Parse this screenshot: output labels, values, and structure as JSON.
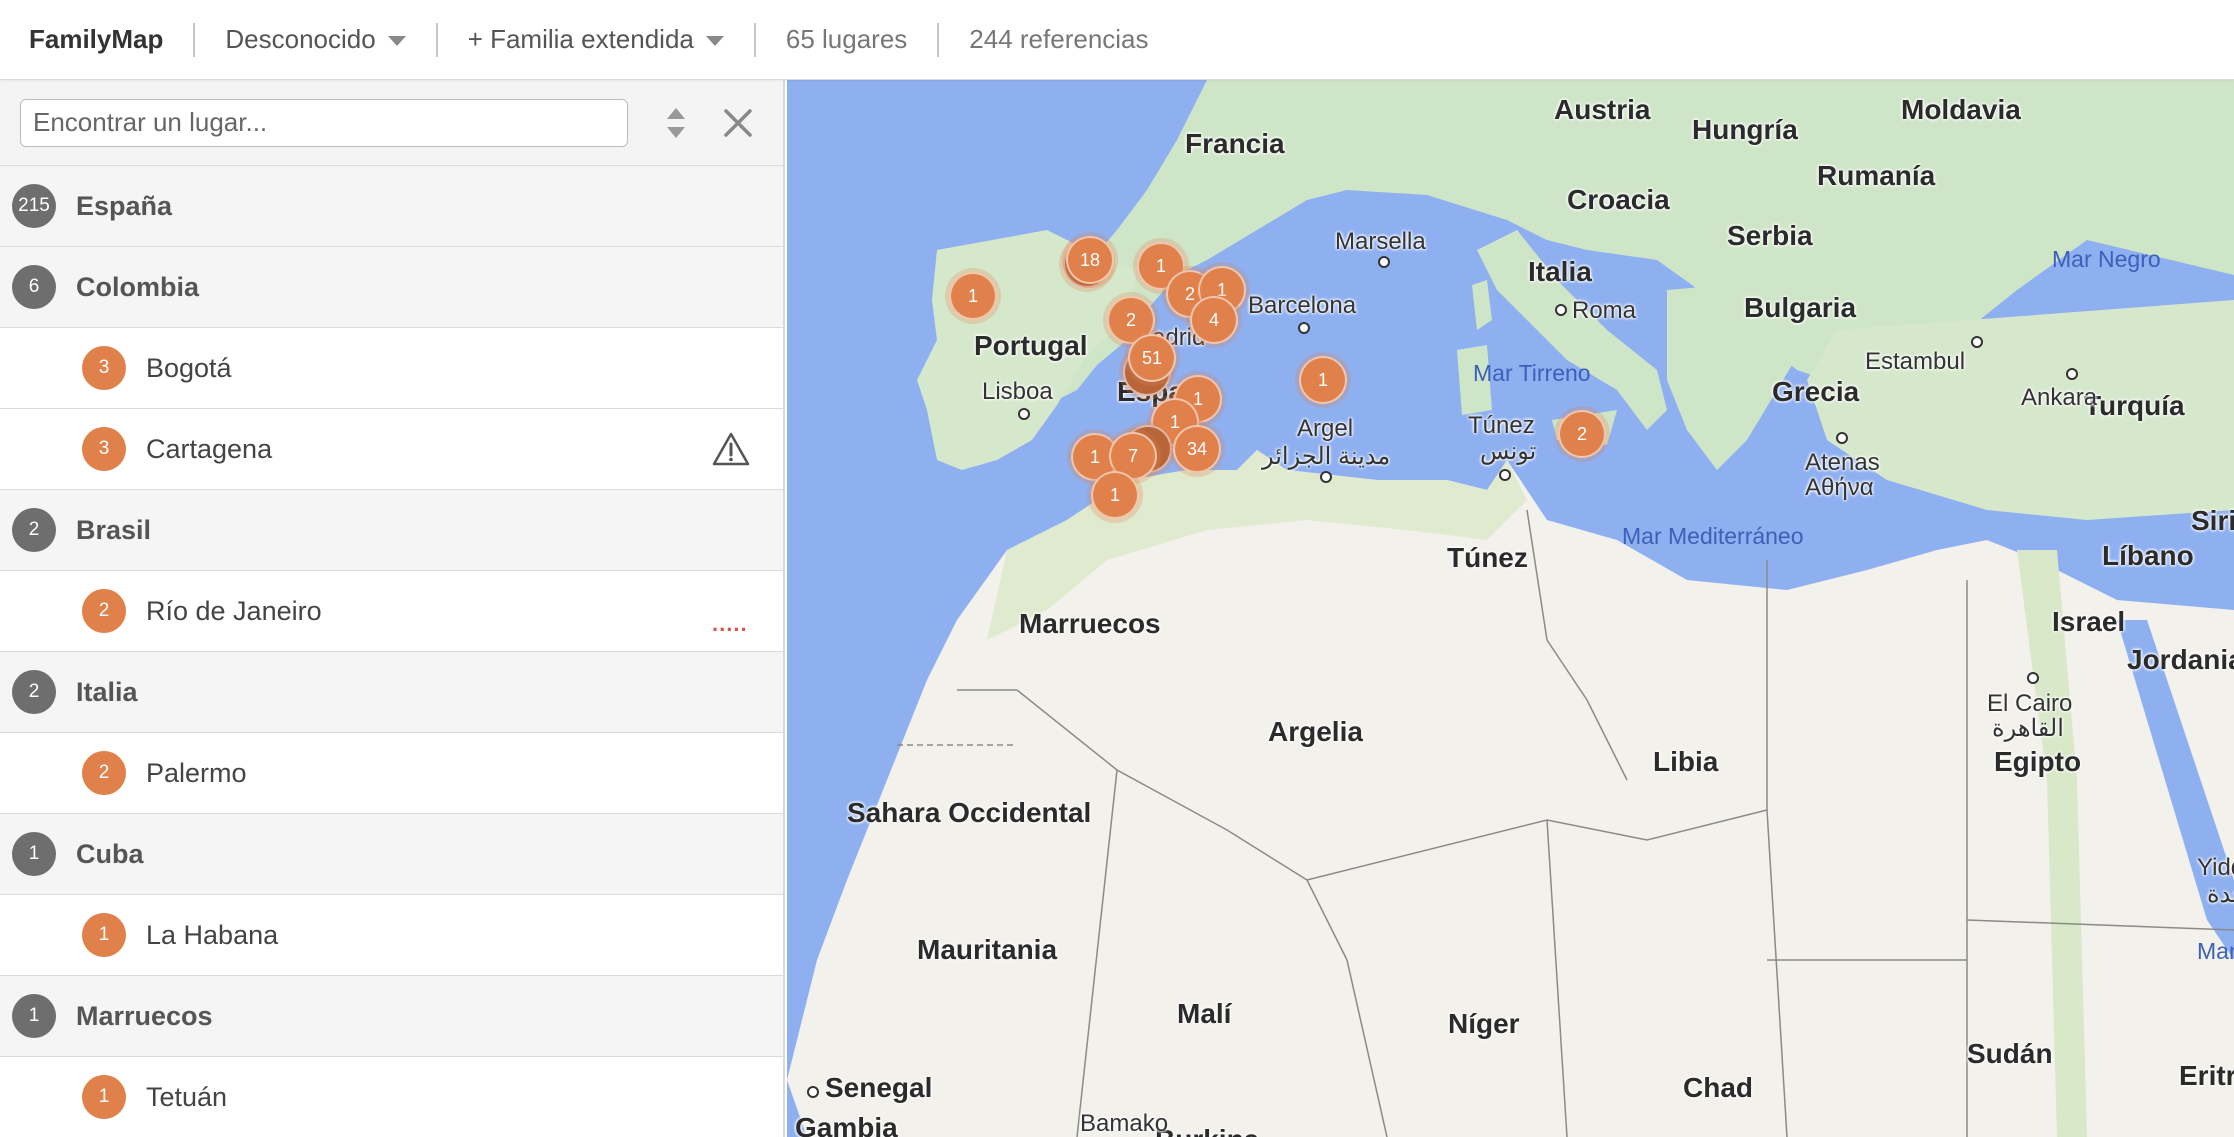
{
  "header": {
    "brand": "FamilyMap",
    "filter_person": "Desconocido",
    "filter_family": "+ Familia extendida",
    "places_count": "65 lugares",
    "references_count": "244 referencias"
  },
  "search": {
    "placeholder": "Encontrar un lugar..."
  },
  "places": [
    {
      "kind": "country",
      "count": "215",
      "name": "España"
    },
    {
      "kind": "country",
      "count": "6",
      "name": "Colombia"
    },
    {
      "kind": "city",
      "count": "3",
      "name": "Bogotá"
    },
    {
      "kind": "city",
      "count": "3",
      "name": "Cartagena",
      "flag": "warning-icon"
    },
    {
      "kind": "country",
      "count": "2",
      "name": "Brasil"
    },
    {
      "kind": "city",
      "count": "2",
      "name": "Río de Janeiro",
      "flag": "dotted"
    },
    {
      "kind": "country",
      "count": "2",
      "name": "Italia"
    },
    {
      "kind": "city",
      "count": "2",
      "name": "Palermo"
    },
    {
      "kind": "country",
      "count": "1",
      "name": "Cuba"
    },
    {
      "kind": "city",
      "count": "1",
      "name": "La Habana"
    },
    {
      "kind": "country",
      "count": "1",
      "name": "Marruecos"
    },
    {
      "kind": "city",
      "count": "1",
      "name": "Tetuán"
    }
  ],
  "map": {
    "countries": [
      "Francia",
      "Austria",
      "Hungría",
      "Moldavia",
      "Rumanía",
      "Croacia",
      "Serbia",
      "Italia",
      "Bulgaria",
      "Portugal",
      "España",
      "Grecia",
      "Turquía",
      "Marruecos",
      "Argelia",
      "Túnez",
      "Libia",
      "Egipto",
      "Líbano",
      "Israel",
      "Jordania",
      "Sahara Occidental",
      "Mauritania",
      "Malí",
      "Níger",
      "Chad",
      "Sudán",
      "Senegal",
      "Gambia",
      "Burkina",
      "Siria",
      "Eritrea"
    ],
    "cities": [
      "Marsella",
      "Barcelona",
      "Roma",
      "Lisboa",
      "Madrid",
      "Argel",
      "مدينة الجزائر",
      "Túnez",
      "تونس",
      "Atenas",
      "Αθήνα",
      "Estambul",
      "Ankara",
      "El Cairo",
      "القاهرة",
      "Bamako",
      "Yidda",
      "جدة"
    ],
    "seas": [
      "Mar Negro",
      "Mar Tirreno",
      "Mar Mediterráneo",
      "Mar Rojo"
    ],
    "markers": [
      "1",
      "18",
      "1",
      "2",
      "1",
      "1",
      "2",
      "4",
      "51",
      "1",
      "1",
      "1",
      "34",
      "1",
      "7",
      "1",
      "2",
      "1"
    ]
  },
  "colors": {
    "marker": "#e0814b",
    "badge_gray": "#6e6e6e",
    "sea": "#8eb0f0",
    "land": "#f3f1ec",
    "green_land": "#cfe5c8"
  }
}
